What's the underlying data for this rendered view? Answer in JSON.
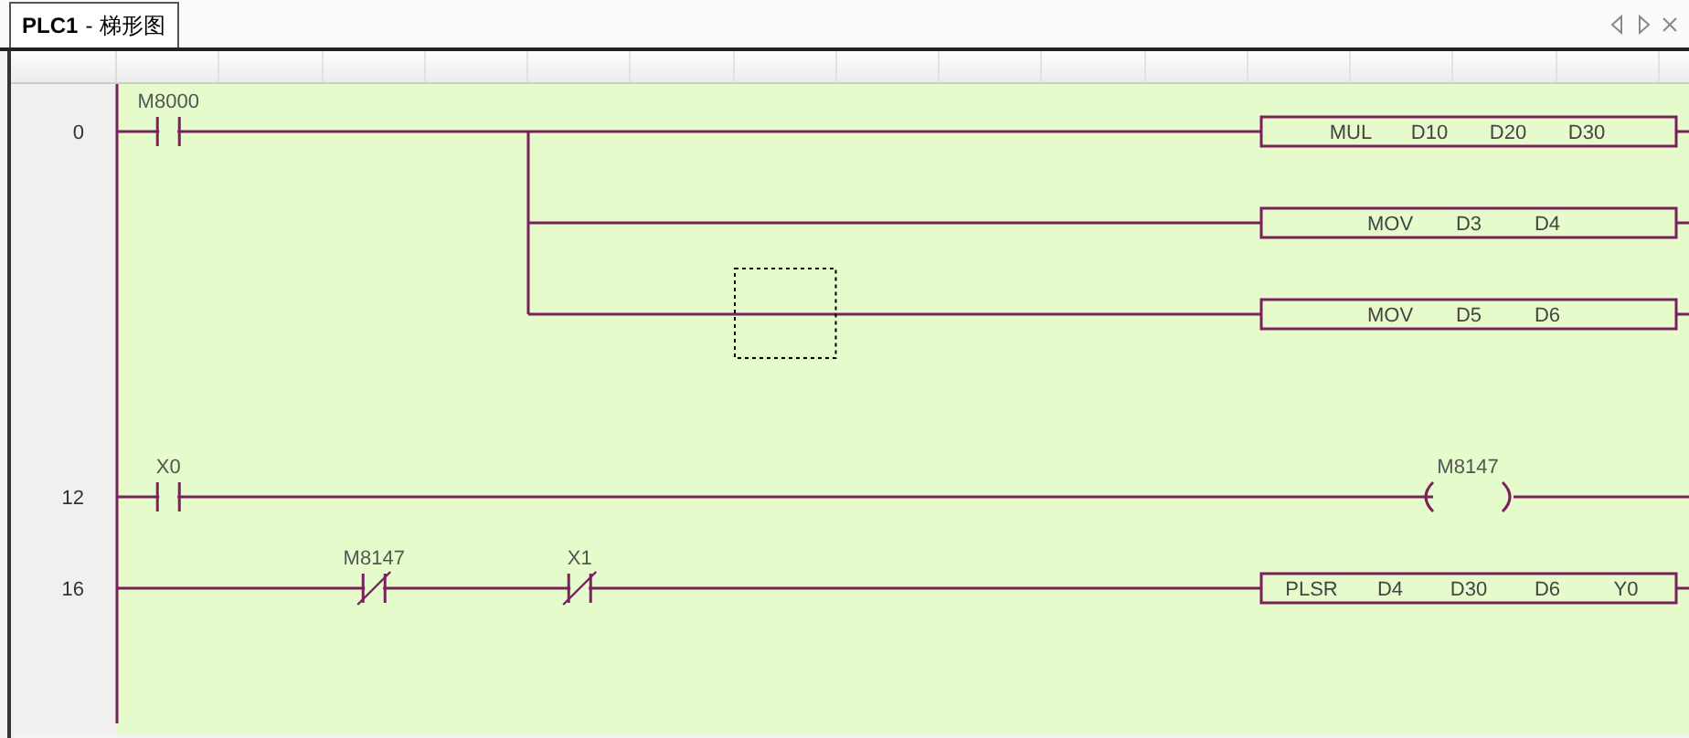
{
  "tab": {
    "title": "PLC1",
    "separator": "-",
    "subtitle": "梯形图",
    "selected": true
  },
  "rows": [
    {
      "kind": "rung",
      "step": "0",
      "selected": false,
      "contacts": [
        {
          "kind": "no",
          "label": "M8000"
        }
      ],
      "output": {
        "kind": "instruction",
        "operands": [
          "MUL",
          "D10",
          "D20",
          "D30"
        ]
      }
    },
    {
      "kind": "branch",
      "selected": false,
      "output": {
        "kind": "instruction",
        "operands": [
          "MOV",
          "D3",
          "D4"
        ]
      }
    },
    {
      "kind": "branch",
      "selected": true,
      "output": {
        "kind": "instruction",
        "operands": [
          "MOV",
          "D5",
          "D6"
        ]
      }
    },
    {
      "kind": "blank",
      "selected": false
    },
    {
      "kind": "rung",
      "step": "12",
      "selected": false,
      "contacts": [
        {
          "kind": "no",
          "label": "X0"
        }
      ],
      "output": {
        "kind": "coil",
        "label": "M8147"
      }
    },
    {
      "kind": "rung",
      "step": "16",
      "selected": false,
      "contacts": [
        {
          "kind": "wire"
        },
        {
          "kind": "wire"
        },
        {
          "kind": "nc",
          "label": "M8147"
        },
        {
          "kind": "wire"
        },
        {
          "kind": "nc",
          "label": "X1"
        }
      ],
      "output": {
        "kind": "instruction",
        "operands": [
          "PLSR",
          "D4",
          "D30",
          "D6",
          "Y0"
        ]
      }
    }
  ]
}
